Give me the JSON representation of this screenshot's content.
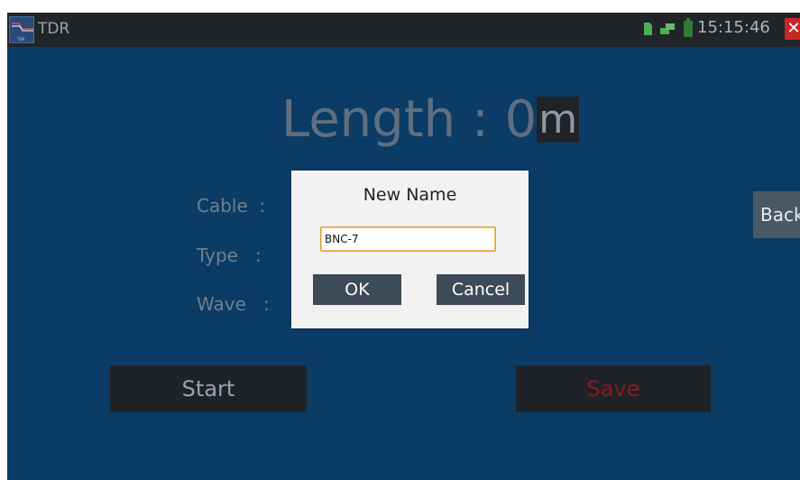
{
  "titlebar": {
    "app_icon": "tdr-app-icon",
    "app_icon_text": "TDR",
    "title": "TDR",
    "clock": "15:15:46",
    "sd_icon": "sd-card-icon",
    "net_icon": "network-icon",
    "battery_icon": "battery-icon",
    "close_icon": "close-icon",
    "close_glyph": "✕"
  },
  "main": {
    "length_label": "Length : 0",
    "length_unit": "m",
    "fields": [
      {
        "label": "Cable  :"
      },
      {
        "label": "Type   :"
      },
      {
        "label": "Wave   :"
      }
    ],
    "back_label": "Back",
    "start_label": "Start",
    "save_label": "Save"
  },
  "dialog": {
    "title": "New Name",
    "input_value": "BNC-7",
    "ok_label": "OK",
    "cancel_label": "Cancel"
  },
  "colors": {
    "background": "#0a3c66",
    "titlebar": "#212529",
    "save_text": "#8b1a1a",
    "input_focus_border": "#e0a030"
  }
}
